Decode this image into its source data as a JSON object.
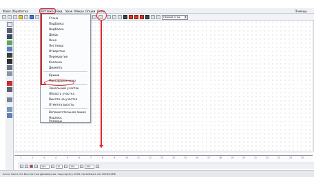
{
  "menubar": {
    "items": [
      "Файл",
      "Обработка",
      "Вставка",
      "Вид",
      "Уров",
      "Макро",
      "Опции",
      "Окно"
    ],
    "help": "Помощь"
  },
  "toolbar": {
    "mode_value": "Первый этаж"
  },
  "insert_menu": {
    "groups": [
      [
        "Стена",
        "Подбалка",
        "Надбалка",
        "Дверь",
        "Окно",
        "Лестница",
        "Отверстие",
        "Перекрытие",
        "Колонна",
        "Диаметр"
      ],
      [
        "Крыша",
        "Мансардное окно"
      ],
      [
        "Земельный участок",
        "Область участка",
        "Высота на участке",
        "Отметка высоты"
      ],
      [
        "Вспомогательная линия",
        "Надпись",
        "Размеры"
      ]
    ]
  },
  "ruler": {
    "numbers": [
      "1",
      "2",
      "3",
      "4",
      "5",
      "6",
      "7",
      "8",
      "9",
      "10",
      "11",
      "12",
      "13",
      "14",
      "15",
      "16",
      "17",
      "18",
      "19",
      "20",
      "21",
      "22",
      "23",
      "24",
      "25"
    ]
  },
  "bottombar": {
    "fields": [
      "100",
      "10",
      "100",
      "100"
    ]
  },
  "status": {
    "text": "ArCon Home 5.0 Бесплатная Демоверсия. Copyright(c) 2006 mb-Software AG 2006/CSME"
  },
  "colors": {
    "annotation": "#e0282a"
  }
}
